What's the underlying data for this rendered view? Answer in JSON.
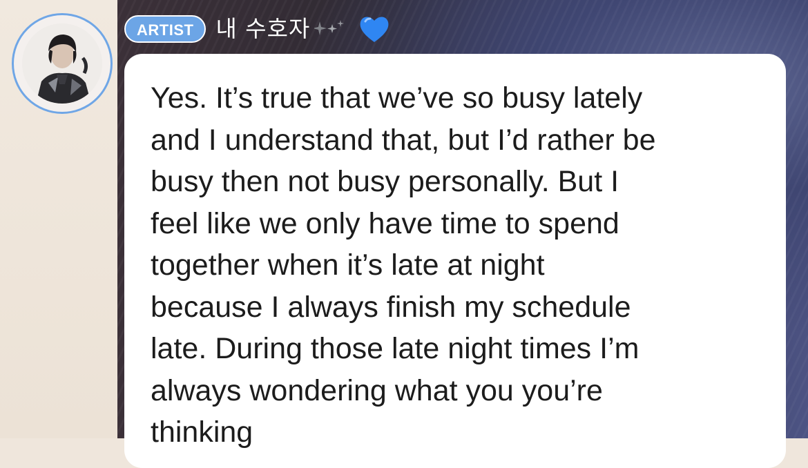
{
  "post": {
    "badge_label": "ARTIST",
    "author_name": "내 수호자",
    "emoji_decoration": "sparkle-icon",
    "emoji_heart": "blue-heart-icon",
    "heart_color": "#2f86f2",
    "badge_color": "#6ca5e6",
    "message": "Yes. It’s true that we’ve so busy lately\nand I understand that, but I’d rather be\nbusy then not busy personally. But I\nfeel like we only have time to spend\ntogether when it’s late at night\nbecause I always finish my schedule\nlate. During those late night times I’m\nalways wondering what you you’re\nthinking"
  }
}
